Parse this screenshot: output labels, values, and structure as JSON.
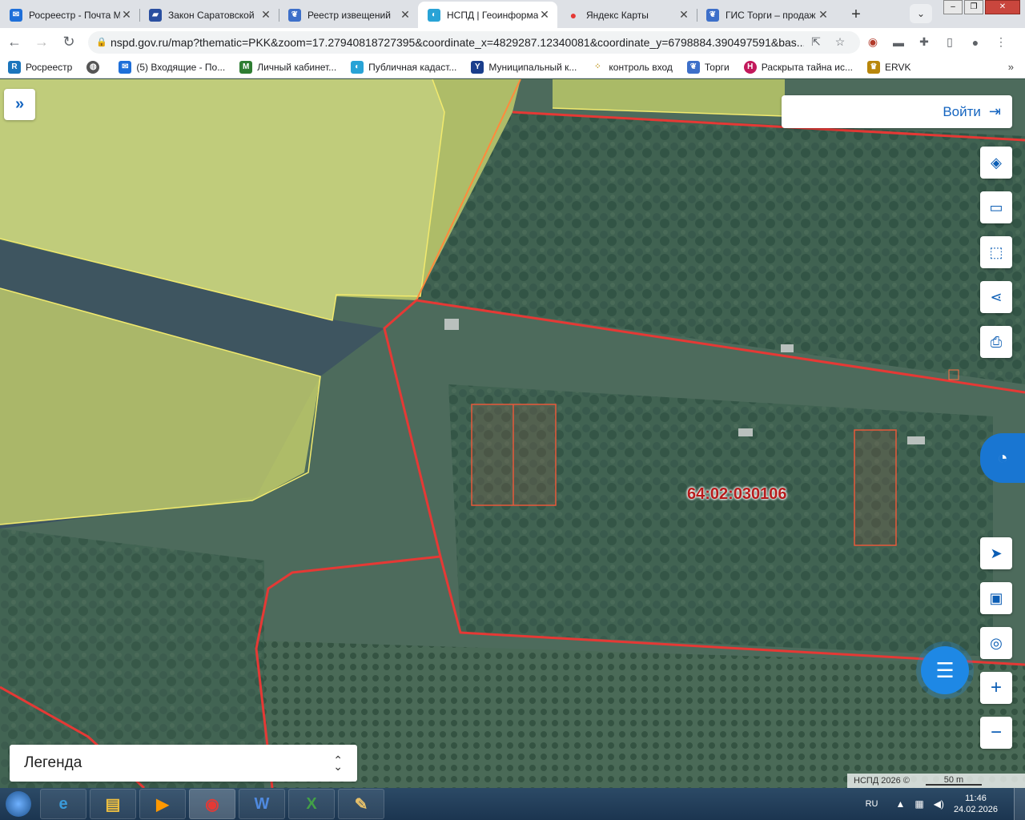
{
  "tabs": [
    {
      "title": "Росреестр - Почта М",
      "icon": "mail-icon",
      "color": "#1e6fd9",
      "active": false
    },
    {
      "title": "Закон Саратовской",
      "icon": "flag-icon",
      "color": "#2a4fa0",
      "active": false
    },
    {
      "title": "Реестр извещений",
      "icon": "emblem-icon",
      "color": "#3d6fc9",
      "active": false
    },
    {
      "title": "НСПД | Геоинформа",
      "icon": "nspd-icon",
      "color": "#29a3d6",
      "active": true
    },
    {
      "title": "Яндекс Карты",
      "icon": "map-pin-icon",
      "color": "#e53935",
      "active": false
    },
    {
      "title": "ГИС Торги – продаж",
      "icon": "emblem-icon",
      "color": "#3d6fc9",
      "active": false
    }
  ],
  "address_bar": {
    "url": "nspd.gov.ru/map?thematic=PKK&zoom=17.27940818727395&coordinate_x=4829287.12340081&coordinate_y=6798884.390497591&bas..."
  },
  "bookmarks": [
    {
      "label": "Росреестр",
      "icon": "rosreestr-icon",
      "color": "#1b75bc"
    },
    {
      "label": "",
      "icon": "globe-icon",
      "color": "#555555"
    },
    {
      "label": "(5) Входящие - По...",
      "icon": "mail-icon",
      "color": "#1e6fd9"
    },
    {
      "label": "Личный кабинет...",
      "icon": "m-logo-icon",
      "color": "#2e7d32"
    },
    {
      "label": "Публичная кадаст...",
      "icon": "cadastre-icon",
      "color": "#29a3d6"
    },
    {
      "label": "Муниципальный к...",
      "icon": "y-icon",
      "color": "#1a3e8c"
    },
    {
      "label": "контроль вход",
      "icon": "dots-icon",
      "color": "#c29b2a"
    },
    {
      "label": "Торги",
      "icon": "emblem-icon",
      "color": "#3d6fc9"
    },
    {
      "label": "Раскрыта тайна ис...",
      "icon": "h-logo-icon",
      "color": "#c2185b"
    },
    {
      "label": "ERVK",
      "icon": "eagle-icon",
      "color": "#b8860b"
    }
  ],
  "map": {
    "login_label": "Войти",
    "parcel_number": "64:02:030106",
    "legend_label": "Легенда",
    "attribution": "НСПД 2026 ©",
    "scale_label": "50 m",
    "boundary_color": "#e53935",
    "field_color": "#c9d46b"
  },
  "taskbar": {
    "apps": [
      "ie",
      "explorer",
      "media",
      "chrome",
      "word",
      "excel",
      "paint"
    ],
    "language": "RU",
    "time": "11:46",
    "date": "24.02.2026"
  }
}
